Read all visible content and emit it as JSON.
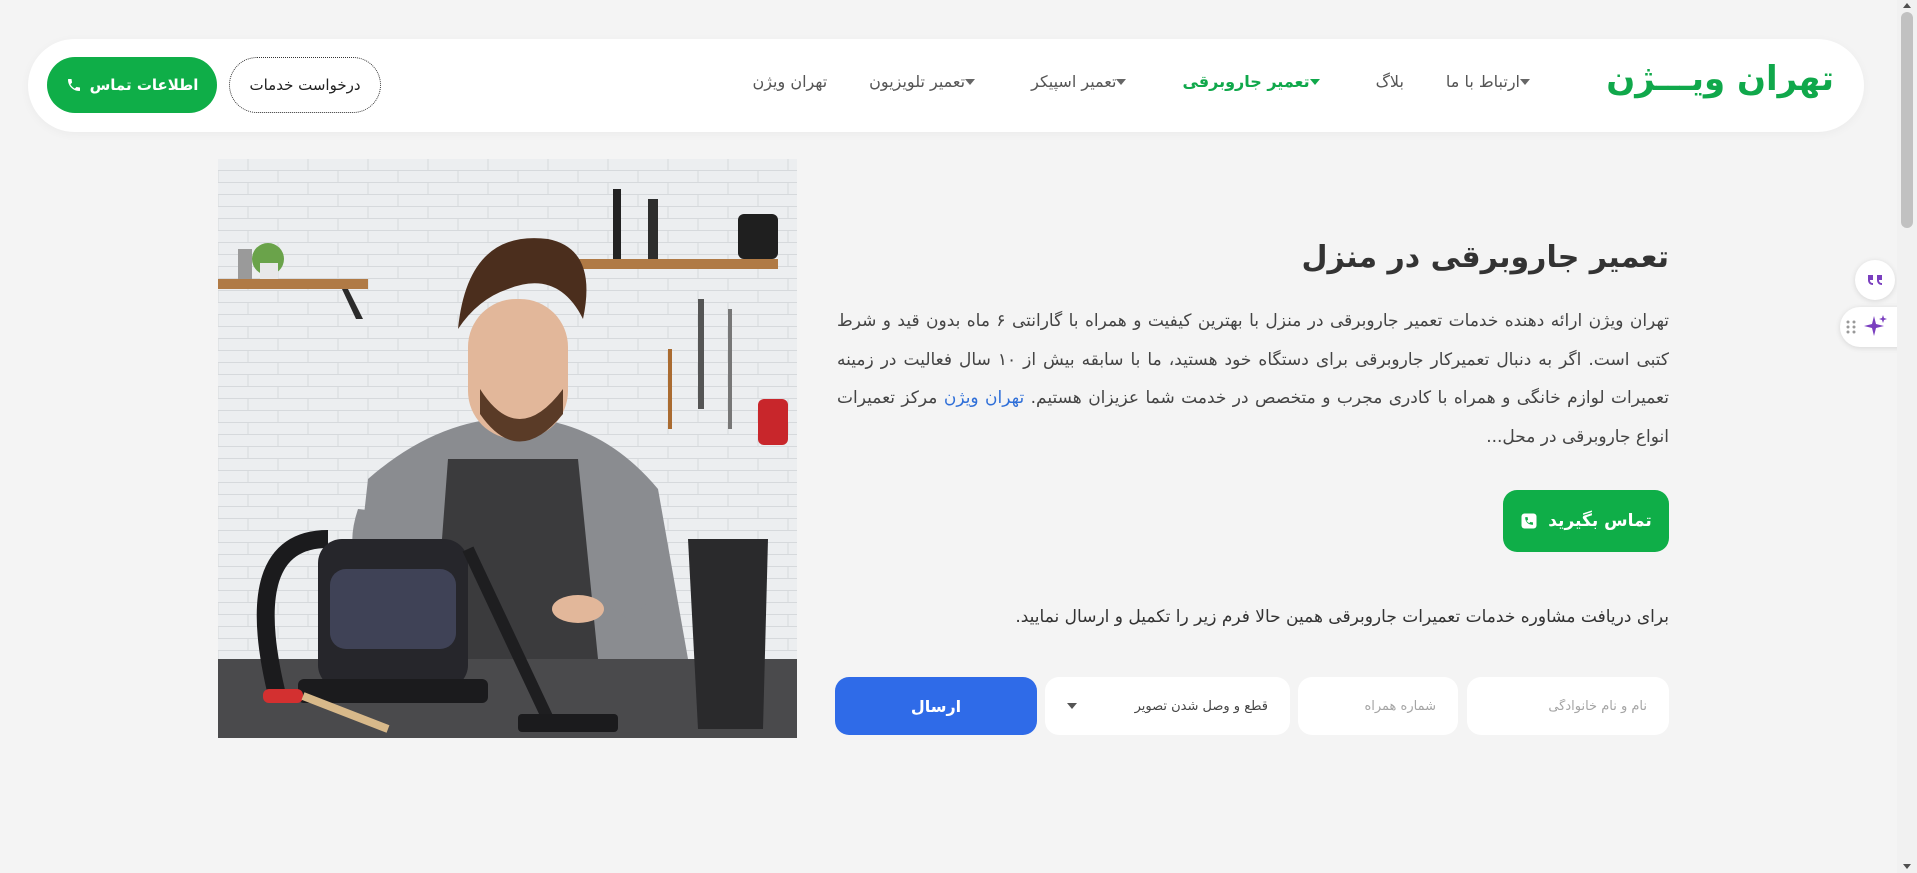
{
  "header": {
    "logo": "تهران ویـــژن",
    "nav": [
      {
        "label": "تهران ویژن",
        "dropdown": false,
        "active": false
      },
      {
        "label": "تعمیر تلویزیون",
        "dropdown": true,
        "active": false
      },
      {
        "label": "تعمیر اسپیکر",
        "dropdown": true,
        "active": false
      },
      {
        "label": "تعمیر جاروبرقی",
        "dropdown": true,
        "active": true
      },
      {
        "label": "بلاگ",
        "dropdown": false,
        "active": false
      },
      {
        "label": "ارتباط با ما",
        "dropdown": true,
        "active": false
      }
    ],
    "request_button": "درخواست خدمات",
    "contact_button": "اطلاعات تماس"
  },
  "hero": {
    "title": "تعمیر جاروبرقی در منزل",
    "description": "تهران ویژن ارائه دهنده خدمات تعمیر جاروبرقی در منزل با بهترین کیفیت و همراه با گارانتی ۶ ماه بدون قید و شرط کتبی است. اگر به دنبال تعمیرکار جاروبرقی برای دستگاه خود هستید، ما با سابقه بیش از ۱۰ سال فعالیت در زمینه تعمیرات لوازم خانگی و همراه با کادری مجرب و متخصص در خدمت شما عزیزان هستیم.",
    "link_text": "تهران ویژن",
    "description_tail": "مرکز تعمیرات انواع جاروبرقی در محل...",
    "call_button": "تماس بگیرید"
  },
  "form": {
    "note": "برای دریافت مشاوره خدمات تعمیرات جاروبرقی همین حالا فرم زیر را تکمیل و ارسال نمایید.",
    "name_placeholder": "نام و نام خانوادگی",
    "phone_placeholder": "شماره همراه",
    "select_value": "قطع و وصل شدن تصویر",
    "submit": "ارسال"
  },
  "colors": {
    "brand_green": "#0fae48",
    "submit_blue": "#2f6be8",
    "link_blue": "#2f6fd8",
    "page_bg": "#f4f4f4"
  },
  "icons": {
    "phone": "phone-icon",
    "quote": "quote-icon",
    "ai": "sparkle-icon",
    "drag": "drag-handle-icon"
  }
}
